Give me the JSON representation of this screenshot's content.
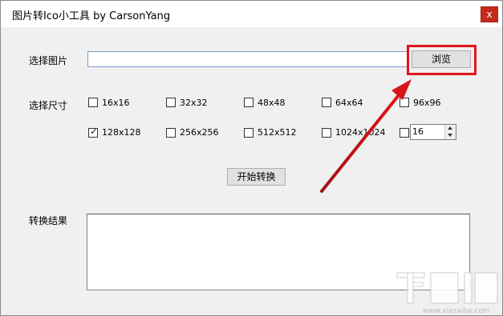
{
  "window": {
    "title": "图片转Ico小工具 by CarsonYang",
    "close_glyph": "x"
  },
  "image_row": {
    "label": "选择图片",
    "path_value": "",
    "browse_label": "浏览"
  },
  "size_section": {
    "label": "选择尺寸",
    "options": [
      {
        "label": "16x16",
        "checked": false
      },
      {
        "label": "32x32",
        "checked": false
      },
      {
        "label": "48x48",
        "checked": false
      },
      {
        "label": "64x64",
        "checked": false
      },
      {
        "label": "96x96",
        "checked": false
      },
      {
        "label": "128x128",
        "checked": true
      },
      {
        "label": "256x256",
        "checked": false
      },
      {
        "label": "512x512",
        "checked": false
      },
      {
        "label": "1024x1024",
        "checked": false
      },
      {
        "label": "",
        "checked": false
      }
    ],
    "custom_size_value": "16"
  },
  "convert": {
    "button_label": "开始转换"
  },
  "result": {
    "label": "转换结果",
    "text": ""
  },
  "annotation": {
    "highlight_color": "#e0161b"
  },
  "watermark": {
    "text": "下载吧"
  }
}
